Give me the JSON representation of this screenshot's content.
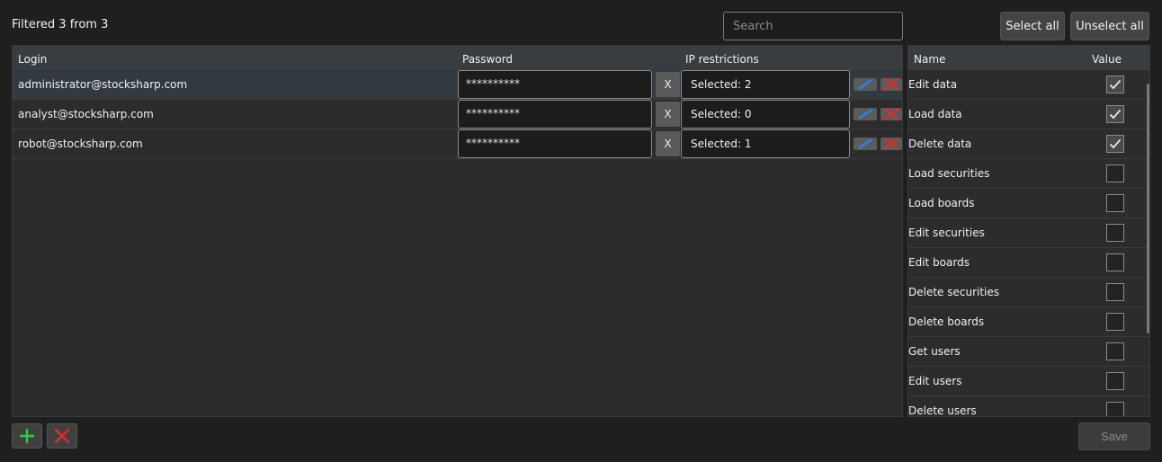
{
  "header": {
    "filter_text": "Filtered 3 from 3",
    "search_placeholder": "Search",
    "select_all_label": "Select all",
    "unselect_all_label": "Unselect all"
  },
  "users_table": {
    "columns": {
      "login": "Login",
      "password": "Password",
      "ip_restrictions": "IP restrictions"
    },
    "rows": [
      {
        "login": "administrator@stocksharp.com",
        "password": "**********",
        "clear_label": "X",
        "ip": "Selected: 2",
        "selected": true
      },
      {
        "login": "analyst@stocksharp.com",
        "password": "**********",
        "clear_label": "X",
        "ip": "Selected: 0",
        "selected": false
      },
      {
        "login": "robot@stocksharp.com",
        "password": "**********",
        "clear_label": "X",
        "ip": "Selected: 1",
        "selected": false
      }
    ]
  },
  "permissions_table": {
    "columns": {
      "name": "Name",
      "value": "Value"
    },
    "rows": [
      {
        "name": "Edit data",
        "checked": true
      },
      {
        "name": "Load data",
        "checked": true
      },
      {
        "name": "Delete data",
        "checked": true
      },
      {
        "name": "Load securities",
        "checked": false
      },
      {
        "name": "Load boards",
        "checked": false
      },
      {
        "name": "Edit securities",
        "checked": false
      },
      {
        "name": "Edit boards",
        "checked": false
      },
      {
        "name": "Delete securities",
        "checked": false
      },
      {
        "name": "Delete boards",
        "checked": false
      },
      {
        "name": "Get users",
        "checked": false
      },
      {
        "name": "Edit users",
        "checked": false
      },
      {
        "name": "Delete users",
        "checked": false
      }
    ]
  },
  "footer": {
    "save_label": "Save"
  },
  "icons": {
    "add": "plus-icon",
    "remove": "close-icon",
    "edit": "pencil-icon",
    "check": "check-icon"
  },
  "colors": {
    "add_icon": "#2ecc40",
    "delete_icon": "#e02b2b",
    "edit_icon": "#2f7fd6",
    "selected_row": "#333a3f"
  }
}
